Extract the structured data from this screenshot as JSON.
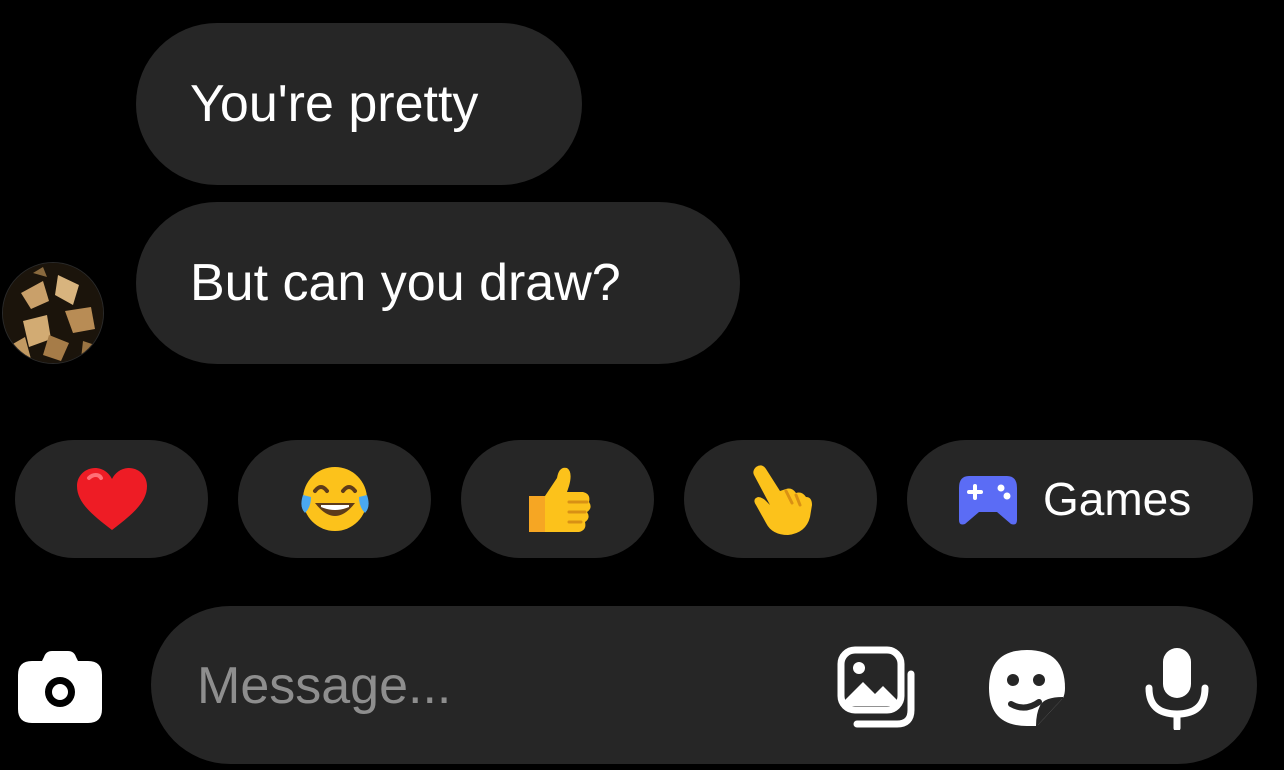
{
  "messages": [
    {
      "text": "You're pretty"
    },
    {
      "text": "But can you draw?"
    }
  ],
  "quick_reactions": [
    {
      "emoji_name": "red-heart-icon"
    },
    {
      "emoji_name": "face-with-tears-of-joy-icon"
    },
    {
      "emoji_name": "thumbs-up-icon"
    },
    {
      "emoji_name": "pointing-hand-icon"
    }
  ],
  "games_chip": {
    "label": "Games",
    "icon": "game-controller-icon"
  },
  "composer": {
    "placeholder": "Message..."
  },
  "colors": {
    "background": "#000000",
    "bubble": "#262626",
    "text": "#ffffff",
    "placeholder": "#8e8e8e",
    "games_accent": "#5b6cf5"
  }
}
